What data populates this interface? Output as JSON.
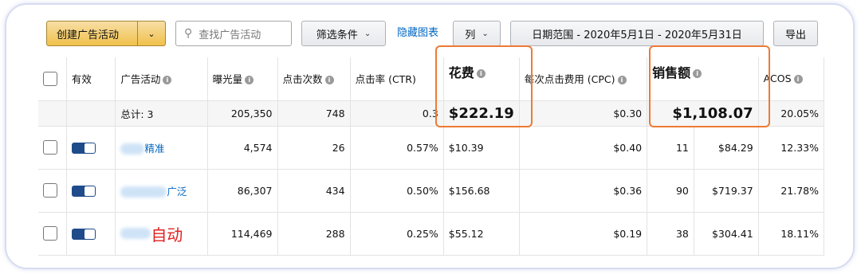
{
  "toolbar": {
    "create_label": "创建广告活动",
    "search_placeholder": "查找广告活动",
    "filter_label": "筛选条件",
    "hide_chart_label": "隐藏图表",
    "columns_label": "列",
    "date_range_label": "日期范围 - 2020年5月1日 - 2020年5月31日",
    "export_label": "导出"
  },
  "table": {
    "headers": {
      "active": "有效",
      "campaign": "广告活动",
      "impressions": "曝光量",
      "clicks": "点击次数",
      "ctr": "点击率 (CTR)",
      "spend": "花费",
      "cpc": "每次点击费用 (CPC)",
      "orders": "",
      "sales": "销售额",
      "acos": "ACOS"
    },
    "total": {
      "label": "总计: 3",
      "impressions": "205,350",
      "clicks": "748",
      "ctr": "0.3",
      "spend": "$222.19",
      "cpc": "$0.30",
      "sales": "$1,108.07",
      "acos": "20.05%"
    },
    "rows": [
      {
        "campaign_suffix": "精准",
        "impressions": "4,574",
        "clicks": "26",
        "ctr": "0.57%",
        "spend": "$10.39",
        "cpc": "$0.40",
        "orders": "11",
        "sales": "$84.29",
        "acos": "12.33%"
      },
      {
        "campaign_suffix": "广泛",
        "impressions": "86,307",
        "clicks": "434",
        "ctr": "0.50%",
        "spend": "$156.68",
        "cpc": "$0.36",
        "orders": "90",
        "sales": "$719.37",
        "acos": "21.78%"
      },
      {
        "campaign_suffix": "自动",
        "impressions": "114,469",
        "clicks": "288",
        "ctr": "0.25%",
        "spend": "$55.12",
        "cpc": "$0.19",
        "orders": "38",
        "sales": "$304.41",
        "acos": "18.11%"
      }
    ]
  },
  "colors": {
    "highlight": "#ec7b35",
    "link": "#0066c0",
    "toggle": "#1f4b8a",
    "annotation": "#e02020"
  }
}
